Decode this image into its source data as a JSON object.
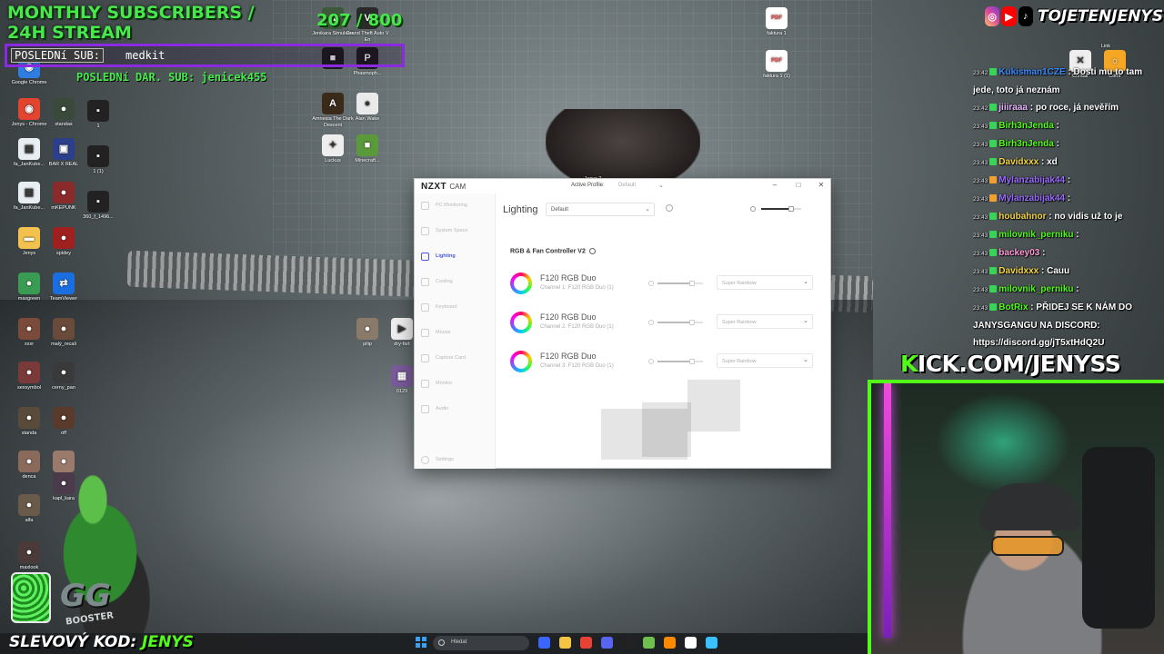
{
  "overlay": {
    "monthly_subs_title": "MONTHLY SUBSCRIBERS / 24H STREAM",
    "sub_counter": "207 / 800",
    "last_sub_label": "POSLEDNí SUB:",
    "last_sub_name": "medkit",
    "last_donation": "POSLEDNí DAR. SUB: jenicek455",
    "discount_label": "SLEVOVÝ KOD:",
    "discount_code": "JENYS",
    "gg": "GG",
    "booster": "BOOSTER",
    "kick_prefix": "K",
    "kick_rest": "ICK.COM/JENYSS",
    "social_handle": "TOJETENJENYS"
  },
  "desktop_icons": [
    {
      "label": "Google Chrome",
      "glyph": "◉",
      "color": "#2f7de1"
    },
    {
      "label": "Jenys - Chrome",
      "glyph": "◉",
      "color": "#e1452f"
    },
    {
      "label": "fa_JanKube...",
      "glyph": "▤",
      "color": "#e9eef3"
    },
    {
      "label": "fa_JanKube...",
      "glyph": "▤",
      "color": "#e9eef3"
    },
    {
      "label": "Jenys",
      "glyph": "▬",
      "color": "#f2c14e"
    },
    {
      "label": "maxgreen",
      "glyph": "●",
      "color": "#3a9b52"
    },
    {
      "label": "xxxr",
      "glyph": "●",
      "color": "#7a4a3a"
    },
    {
      "label": "sexsymbol",
      "glyph": "●",
      "color": "#7a3a3a"
    },
    {
      "label": "standa",
      "glyph": "●",
      "color": "#5a4a3a"
    },
    {
      "label": "denca",
      "glyph": "●",
      "color": "#8a6a5a"
    },
    {
      "label": "alfa",
      "glyph": "●",
      "color": "#6a5a4a"
    },
    {
      "label": "maxlook",
      "glyph": "●",
      "color": "#4a3a3a"
    },
    {
      "label": "denca",
      "glyph": "●",
      "color": "#9a7a6a"
    },
    {
      "label": "standas",
      "glyph": "●",
      "color": "#3a4a3a"
    },
    {
      "label": "BAR X REAL",
      "glyph": "▣",
      "color": "#2b3f8a"
    },
    {
      "label": "mKEPUNK",
      "glyph": "●",
      "color": "#8a2a2a"
    },
    {
      "label": "spidey",
      "glyph": "●",
      "color": "#a02020"
    },
    {
      "label": "TeamViewer",
      "glyph": "⇄",
      "color": "#1b6ee0"
    },
    {
      "label": "malý_recali",
      "glyph": "●",
      "color": "#6a4a3a"
    },
    {
      "label": "cerny_pan",
      "glyph": "●",
      "color": "#3a3a3a"
    },
    {
      "label": "off",
      "glyph": "●",
      "color": "#5a3a2a"
    },
    {
      "label": "kapl_kara",
      "glyph": "●",
      "color": "#4a3a4a"
    },
    {
      "label": "1",
      "glyph": "▪",
      "color": "#222222"
    },
    {
      "label": "1 (1)",
      "glyph": "▪",
      "color": "#222222"
    },
    {
      "label": "360_f_1496...",
      "glyph": "▪",
      "color": "#222222"
    },
    {
      "label": "Jenikara Simulator",
      "glyph": "▲",
      "color": "#3a5a3a"
    },
    {
      "label": "Grand Theft Auto V En",
      "glyph": "V",
      "color": "#2a2a2a"
    },
    {
      "label": "",
      "glyph": "■",
      "color": "#1a1a1a"
    },
    {
      "label": "Phasmoph...",
      "glyph": "P",
      "color": "#1a1a1a"
    },
    {
      "label": "Amnesia The Dark Descent",
      "glyph": "A",
      "color": "#3a2a1a"
    },
    {
      "label": "Alan Wake",
      "glyph": "●",
      "color": "#eaeaea"
    },
    {
      "label": "Luckus",
      "glyph": "✦",
      "color": "#eeeeee"
    },
    {
      "label": "Minecraft...",
      "glyph": "■",
      "color": "#5a9a3a"
    },
    {
      "label": "pilip",
      "glyph": "●",
      "color": "#8a7a6a"
    },
    {
      "label": "dry-fart",
      "glyph": "▶",
      "color": "#eeeeee"
    },
    {
      "label": "0129",
      "glyph": "▦",
      "color": "#7a5a9a"
    },
    {
      "label": "Jenys 2",
      "glyph": "",
      "color": "transparent"
    },
    {
      "label": "faktura 1",
      "glyph": "PDF",
      "color": "#e44"
    },
    {
      "label": "faktura 1 (1)",
      "glyph": "PDF",
      "color": "#e44"
    },
    {
      "label": "Link",
      "glyph": "",
      "color": "transparent"
    },
    {
      "label": "Corsair",
      "glyph": "✕",
      "color": "#eeeeee"
    },
    {
      "label": "Contr",
      "glyph": "☼",
      "color": "#f5a623"
    }
  ],
  "chat": [
    {
      "time": "23:42",
      "badge": "#3ad35a",
      "user": "Kukisman1CZE",
      "user_color": "#3a8bff",
      "msg": "Dosti mu to tam jede, toto já neznám"
    },
    {
      "time": "23:42",
      "badge": "#3ad35a",
      "user": "jiiiraaa",
      "user_color": "#e6b8ff",
      "msg": "po roce, já nevěřím"
    },
    {
      "time": "23:43",
      "badge": "#3ad35a",
      "user": "Birh3nJenda",
      "user_color": "#53fc18",
      "msg": ""
    },
    {
      "time": "23:43",
      "badge": "#3ad35a",
      "user": "Birh3nJenda",
      "user_color": "#53fc18",
      "msg": ""
    },
    {
      "time": "23:43",
      "badge": "#3ad35a",
      "user": "Davidxxx",
      "user_color": "#f5d442",
      "msg": "xd"
    },
    {
      "time": "23:43",
      "badge": "#f0a030",
      "user": "Mylanzabijak44",
      "user_color": "#9b6bff",
      "msg": ""
    },
    {
      "time": "23:43",
      "badge": "#f0a030",
      "user": "Mylanzabijak44",
      "user_color": "#9b6bff",
      "msg": ""
    },
    {
      "time": "23:43",
      "badge": "#3ad35a",
      "user": "houbahnor",
      "user_color": "#f5d442",
      "msg": "no vidis už to je"
    },
    {
      "time": "23:43",
      "badge": "#3ad35a",
      "user": "milovnik_perniku",
      "user_color": "#53fc18",
      "msg": ""
    },
    {
      "time": "23:43",
      "badge": "#3ad35a",
      "user": "backey03",
      "user_color": "#ff9ad5",
      "msg": ""
    },
    {
      "time": "23:43",
      "badge": "#3ad35a",
      "user": "Davidxxx",
      "user_color": "#f5d442",
      "msg": "Cauu"
    },
    {
      "time": "23:43",
      "badge": "#3ad35a",
      "user": "milovnik_perniku",
      "user_color": "#53fc18",
      "msg": ""
    },
    {
      "time": "23:43",
      "badge": "#3ad35a",
      "user": "BotRix",
      "user_color": "#53fc18",
      "msg": "PŘIDEJ SE K NÁM DO JANYSGANGU NA DISCORD: https://discord.gg/jT5xtHdQ2U"
    }
  ],
  "nzxt": {
    "logo": "NZXT",
    "logo_sub": "CAM",
    "active_profile_label": "Active Profile:",
    "active_profile_value": "Default",
    "heading": "Lighting",
    "dropdown_value": "Default",
    "section_title": "RGB & Fan Controller V2",
    "brightness_fraction": 0.75,
    "nav": [
      {
        "label": "PC Monitoring",
        "active": false
      },
      {
        "label": "System Specs",
        "active": false
      },
      {
        "label": "Lighting",
        "active": true
      },
      {
        "label": "Cooling",
        "active": false
      },
      {
        "label": "Keyboard",
        "active": false
      },
      {
        "label": "Mouse",
        "active": false
      },
      {
        "label": "Capture Card",
        "active": false
      },
      {
        "label": "Monitor",
        "active": false
      },
      {
        "label": "Audio",
        "active": false
      }
    ],
    "settings_label": "Settings",
    "devices": [
      {
        "name": "F120 RGB Duo",
        "channel": "Channel 1: F120 RGB Duo (1)",
        "effect": "Super Rainbow",
        "speed_fraction": 0.75
      },
      {
        "name": "F120 RGB Duo",
        "channel": "Channel 2: F120 RGB Duo (1)",
        "effect": "Super Rainbow",
        "speed_fraction": 0.75
      },
      {
        "name": "F120 RGB Duo",
        "channel": "Channel 3: F120 RGB Duo (1)",
        "effect": "Super Rainbow",
        "speed_fraction": 0.75
      }
    ]
  },
  "taskbar": {
    "search_placeholder": "Hledat",
    "apps": [
      "#3a66ff",
      "#f4c542",
      "#e94235",
      "#5865f2",
      "#222222",
      "#6fbf4e",
      "#ff8a00",
      "#ffffff",
      "#3ac1ff"
    ]
  }
}
